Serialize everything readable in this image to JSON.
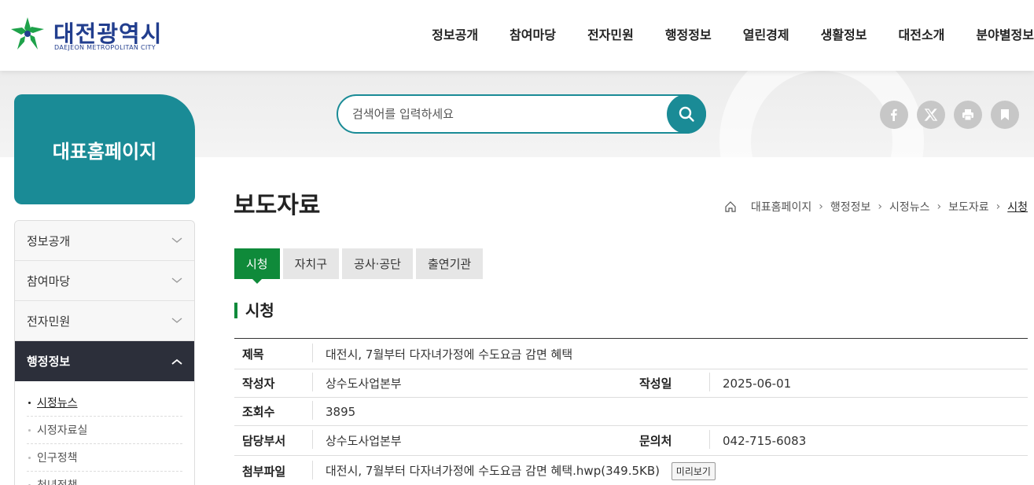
{
  "header": {
    "logo_name": "대전광역시",
    "logo_sub": "DAEJEON METROPOLITAN CITY",
    "gnb": [
      "정보공개",
      "참여마당",
      "전자민원",
      "행정정보",
      "열린경제",
      "생활정보",
      "대전소개",
      "분야별정보"
    ]
  },
  "search": {
    "placeholder": "검색어를 입력하세요",
    "icon": "search-icon"
  },
  "share": {
    "icons": [
      "facebook-icon",
      "x-icon",
      "print-icon",
      "bookmark-icon"
    ]
  },
  "sidebar": {
    "title": "대표홈페이지",
    "items": [
      {
        "label": "정보공개",
        "expanded": false
      },
      {
        "label": "참여마당",
        "expanded": false
      },
      {
        "label": "전자민원",
        "expanded": false
      },
      {
        "label": "행정정보",
        "expanded": true
      }
    ],
    "sub_items": [
      {
        "label": "시정뉴스",
        "current": true
      },
      {
        "label": "시정자료실",
        "current": false
      },
      {
        "label": "인구정책",
        "current": false
      },
      {
        "label": "청년정책",
        "current": false
      }
    ]
  },
  "page": {
    "title": "보도자료",
    "breadcrumb": [
      "대표홈페이지",
      "행정정보",
      "시정뉴스",
      "보도자료",
      "시청"
    ]
  },
  "tabs": [
    {
      "label": "시청",
      "selected": true
    },
    {
      "label": "자치구",
      "selected": false
    },
    {
      "label": "공사·공단",
      "selected": false
    },
    {
      "label": "출연기관",
      "selected": false
    }
  ],
  "section_title": "시청",
  "article": {
    "title_label": "제목",
    "title": "대전시, 7월부터 다자녀가정에 수도요금 감면 혜택",
    "author_label": "작성자",
    "author": "상수도사업본부",
    "date_label": "작성일",
    "date": "2025-06-01",
    "views_label": "조회수",
    "views": "3895",
    "dept_label": "담당부서",
    "dept": "상수도사업본부",
    "contact_label": "문의처",
    "contact": "042-715-6083",
    "attach_label": "첨부파일",
    "attach": "대전시, 7월부터 다자녀가정에 수도요금 감면 혜택.hwp(349.5KB)",
    "preview_label": "미리보기"
  },
  "colors": {
    "brand_teal": "#1a8b96",
    "tab_green": "#0f8a3a",
    "logo_navy": "#223e8e",
    "sidebar_active": "#2c2f3a"
  }
}
